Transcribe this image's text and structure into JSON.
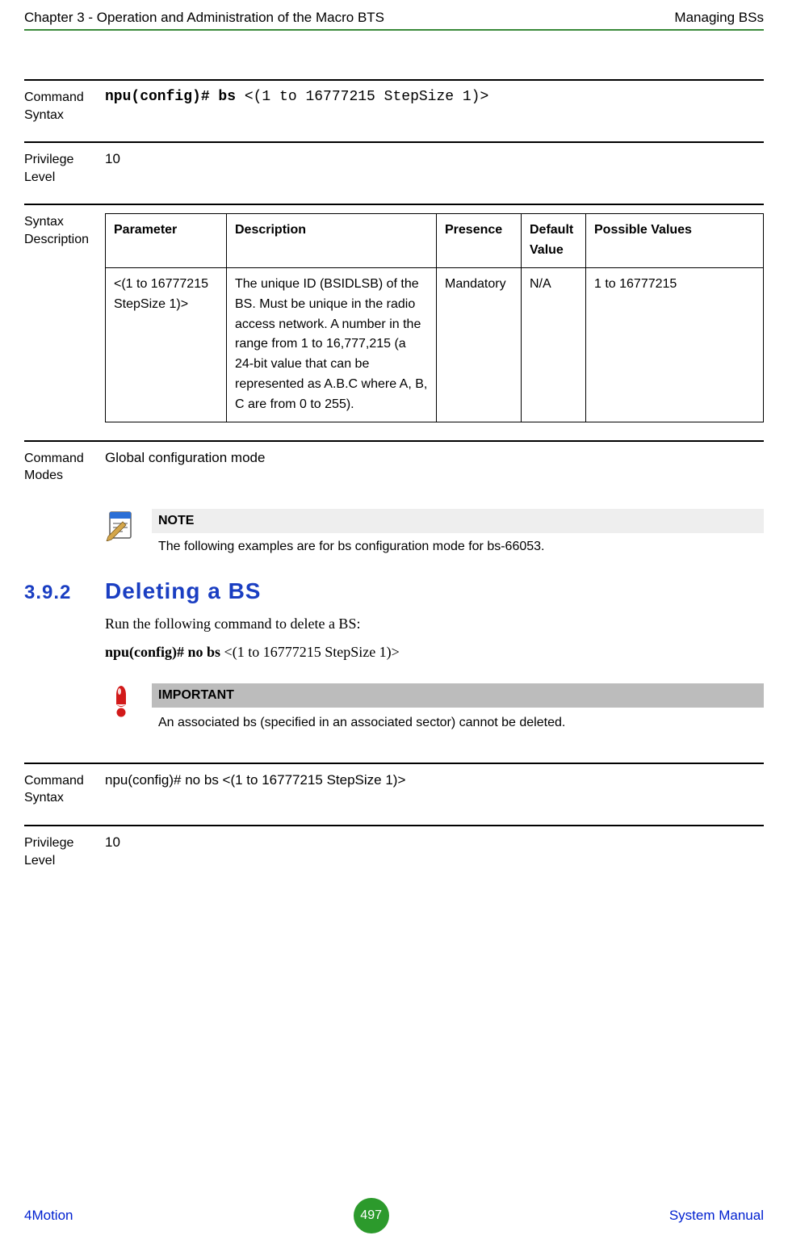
{
  "header": {
    "left": "Chapter 3 - Operation and Administration of the Macro BTS",
    "right": "Managing BSs"
  },
  "block1": {
    "cmd_syntax_label": "Command Syntax",
    "cmd_syntax_bold": "npu(config)# bs",
    "cmd_syntax_rest": " <(1 to 16777215 StepSize 1)>",
    "priv_label": "Privilege Level",
    "priv_value": "10",
    "syndesc_label": "Syntax Description",
    "table": {
      "headers": [
        "Parameter",
        "Description",
        "Presence",
        "Default Value",
        "Possible Values"
      ],
      "row": {
        "param": "<(1 to 16777215 StepSize 1)>",
        "desc": "The unique ID (BSIDLSB) of the BS. Must be unique in the radio access network. A number in the range from 1 to 16,777,215 (a 24-bit value that can be represented as A.B.C where A, B, C are from 0 to 255).",
        "presence": "Mandatory",
        "default": "N/A",
        "possible": "1 to 16777215"
      }
    },
    "cmd_modes_label": "Command Modes",
    "cmd_modes_value": "Global configuration mode"
  },
  "note": {
    "title": "NOTE",
    "text": "The following examples are for bs configuration mode for bs-66053."
  },
  "section": {
    "num": "3.9.2",
    "title": "Deleting a BS",
    "para": "Run the following command to delete a BS:",
    "cmd_bold": "npu(config)# no bs",
    "cmd_rest": " <(1 to 16777215 StepSize 1)>"
  },
  "important": {
    "title": "IMPORTANT",
    "text": "An associated bs (specified in an associated sector) cannot be deleted."
  },
  "block2": {
    "cmd_syntax_label": "Command Syntax",
    "cmd_syntax_value": "npu(config)# no bs <(1 to 16777215 StepSize 1)>",
    "priv_label": "Privilege Level",
    "priv_value": "10"
  },
  "footer": {
    "left": "4Motion",
    "page": "497",
    "right": "System Manual"
  }
}
